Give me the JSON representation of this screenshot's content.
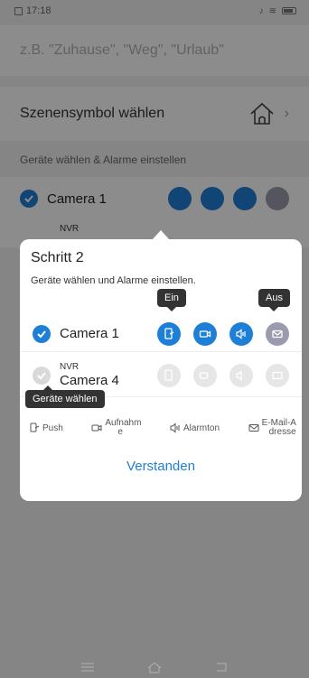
{
  "status_bar": {
    "time": "17:18"
  },
  "background": {
    "name_placeholder": "z.B. \"Zuhause\", \"Weg\", \"Urlaub\"",
    "scene_icon_label": "Szenensymbol wählen",
    "section_heading": "Geräte wählen & Alarme einstellen",
    "rows": [
      {
        "name": "Camera 1",
        "checked": true
      },
      {
        "small_label": "NVR"
      }
    ]
  },
  "popup": {
    "title": "Schritt 2",
    "description": "Geräte wählen und Alarme einstellen.",
    "tooltips": {
      "on": "Ein",
      "off": "Aus",
      "select_devices": "Geräte wählen"
    },
    "devices": [
      {
        "name": "Camera 1",
        "checked": true,
        "group": ""
      },
      {
        "name": "Camera 4",
        "checked": false,
        "group": "NVR"
      }
    ],
    "legend": {
      "push": "Push",
      "recording_line1": "Aufnahm",
      "recording_line2": "e",
      "alarm_tone": "Alarmton",
      "email_line1": "E-Mail-A",
      "email_line2": "dresse"
    },
    "confirm_button": "Verstanden"
  },
  "colors": {
    "accent": "#1e7fd6",
    "disabled_icon": "#e6e6e6",
    "email_icon": "#9b9bb0"
  },
  "icons": [
    "home-icon",
    "chevron-right-icon",
    "push-icon",
    "record-icon",
    "alarm-tone-icon",
    "email-icon",
    "check-icon"
  ]
}
